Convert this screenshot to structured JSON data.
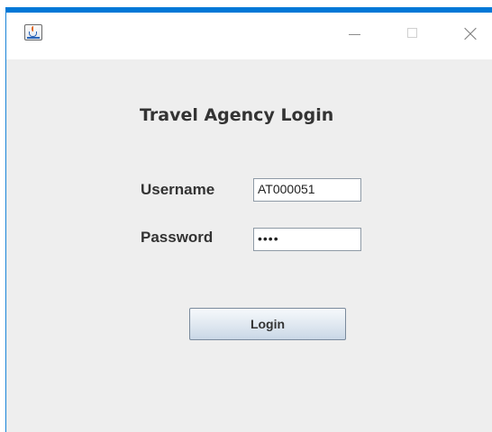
{
  "window": {
    "icon": "java-cup-icon",
    "controls": {
      "minimize": "minimize-icon",
      "maximize": "maximize-icon",
      "close": "close-icon"
    },
    "accent_color": "#0078d7"
  },
  "form": {
    "title": "Travel Agency Login",
    "username_label": "Username",
    "username_value": "AT000051",
    "password_label": "Password",
    "password_value": "••••",
    "login_button": "Login"
  }
}
